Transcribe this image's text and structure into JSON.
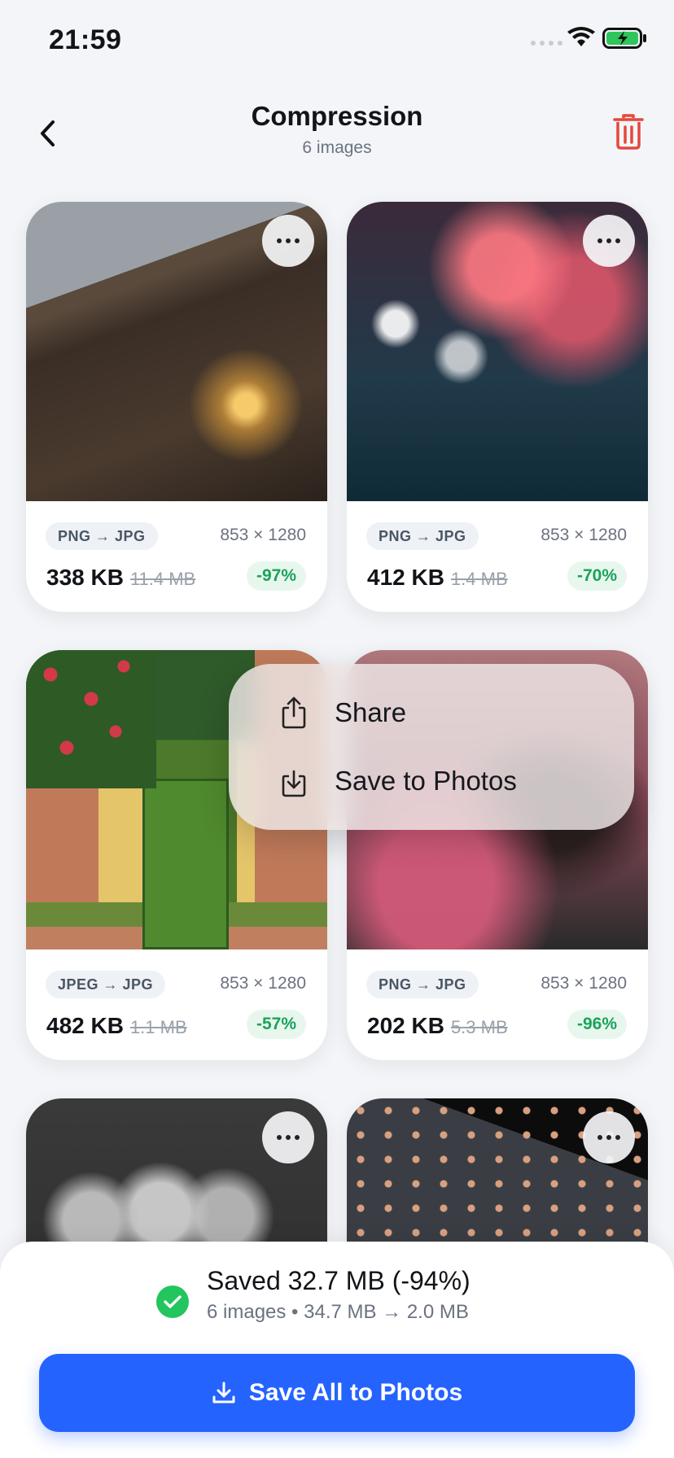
{
  "status_bar": {
    "time": "21:59"
  },
  "header": {
    "title": "Compression",
    "subtitle": "6 images"
  },
  "cards": [
    {
      "format": "PNG → JPG",
      "dims": "853 × 1280",
      "new_size": "338 KB",
      "old_size": "11.4 MB",
      "pct": "-97%",
      "has_more": true
    },
    {
      "format": "PNG → JPG",
      "dims": "853 × 1280",
      "new_size": "412 KB",
      "old_size": "1.4 MB",
      "pct": "-70%",
      "has_more": true
    },
    {
      "format": "JPEG → JPG",
      "dims": "853 × 1280",
      "new_size": "482 KB",
      "old_size": "1.1 MB",
      "pct": "-57%",
      "has_more": false
    },
    {
      "format": "PNG → JPG",
      "dims": "853 × 1280",
      "new_size": "202 KB",
      "old_size": "5.3 MB",
      "pct": "-96%",
      "has_more": false
    },
    {
      "has_more": true
    },
    {
      "has_more": true
    }
  ],
  "context_menu": {
    "share_label": "Share",
    "save_label": "Save to Photos"
  },
  "summary": {
    "saved_text": "Saved 32.7 MB (-94%)",
    "detail_text": "6 images • 34.7 MB → 2.0 MB",
    "button_label": "Save All to Photos"
  },
  "colors": {
    "accent": "#2563ff",
    "success": "#1aa35a",
    "danger": "#e5483a"
  },
  "icons": [
    "back-chevron-icon",
    "trash-icon",
    "more-icon",
    "share-icon",
    "save-to-photos-icon",
    "checkmark-icon",
    "download-icon",
    "wifi-icon",
    "battery-charging-icon"
  ]
}
